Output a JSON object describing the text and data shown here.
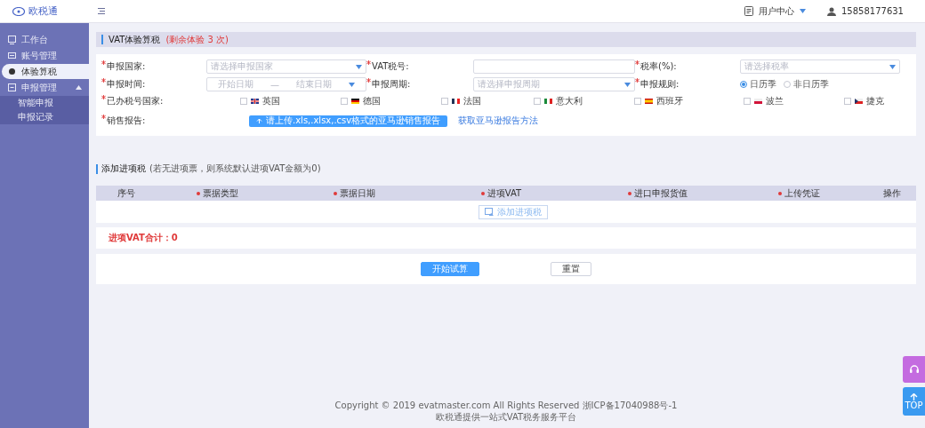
{
  "logo": {
    "text": "欧税通"
  },
  "header": {
    "user_center": "用户中心",
    "phone": "15858177631"
  },
  "sidebar": {
    "items": [
      {
        "label": "工作台",
        "selected": false
      },
      {
        "label": "账号管理",
        "selected": false
      },
      {
        "label": "体验算税",
        "selected": true
      },
      {
        "label": "申报管理",
        "selected": false,
        "expanded": true,
        "children": [
          {
            "label": "智能申报",
            "selected": false
          },
          {
            "label": "申报记录",
            "selected": false
          }
        ]
      }
    ]
  },
  "panel": {
    "title": "VAT体验算税",
    "note": "(剩余体验 3 次)"
  },
  "form": {
    "fields": [
      {
        "kind": "select",
        "label": "申报国家:",
        "placeholder": "请选择申报国家"
      },
      {
        "kind": "input",
        "label": "VAT税号:"
      },
      {
        "kind": "select",
        "label": "税率(%):",
        "placeholder": "请选择税率"
      },
      {
        "kind": "daterange",
        "label": "申报时间:",
        "start": "开始日期",
        "separator": "—",
        "end": "结束日期"
      },
      {
        "kind": "select",
        "label": "申报周期:",
        "placeholder": "请选择申报周期"
      },
      {
        "kind": "radio",
        "label": "申报规则:",
        "options": [
          {
            "label": "日历季",
            "selected": true
          },
          {
            "label": "非日历季",
            "selected": false
          }
        ]
      }
    ],
    "countries_label": "已办税号国家:",
    "countries": [
      {
        "label": "英国",
        "kind": "uk",
        "checked": false
      },
      {
        "label": "德国",
        "kind": "de",
        "checked": false
      },
      {
        "label": "法国",
        "kind": "fr",
        "checked": false
      },
      {
        "label": "意大利",
        "kind": "it",
        "checked": false
      },
      {
        "label": "西班牙",
        "kind": "es",
        "checked": false
      },
      {
        "label": "波兰",
        "kind": "pl",
        "checked": false
      },
      {
        "label": "捷克",
        "kind": "cz",
        "checked": false
      }
    ],
    "report_label": "销售报告:",
    "upload_button": "请上传.xls,.xlsx,.csv格式的亚马逊销售报告",
    "help_link": "获取亚马逊报告方法"
  },
  "input_tax": {
    "title": "添加进项税",
    "note": "(若无进项票，则系统默认进项VAT金额为0)",
    "columns": [
      {
        "label": "序号",
        "required": false
      },
      {
        "label": "票据类型",
        "required": true
      },
      {
        "label": "票据日期",
        "required": true
      },
      {
        "label": "进项VAT",
        "required": true
      },
      {
        "label": "进口申报货值",
        "required": true
      },
      {
        "label": "上传凭证",
        "required": true
      },
      {
        "label": "操作",
        "required": false
      }
    ],
    "add_button": "添加进项税",
    "total": "进项VAT合计：0"
  },
  "actions": [
    "开始试算",
    "重置"
  ],
  "footer": [
    "Copyright © 2019 evatmaster.com All Rights Reserved 浙ICP备17040988号-1",
    "欧税通提供一站式VAT税务服务平台"
  ],
  "float": {
    "top": "TOP"
  }
}
